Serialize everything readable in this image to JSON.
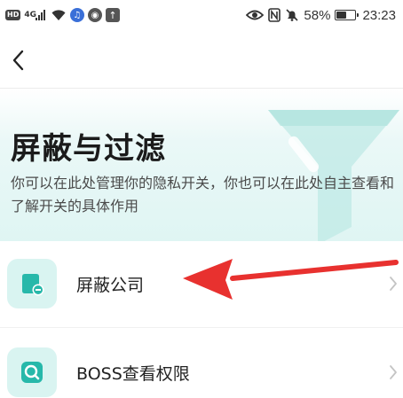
{
  "status_bar": {
    "hd_label": "HD",
    "network_label": "4G",
    "battery_percent": "58%",
    "battery_level": 0.58,
    "time": "23:23",
    "icons": [
      "hd-icon",
      "signal-icon",
      "wifi-icon",
      "music-icon",
      "browser-icon",
      "upload-icon",
      "eye-icon",
      "nfc-icon",
      "mute-icon",
      "battery-icon"
    ]
  },
  "nav": {
    "back_icon": "chevron-left-icon"
  },
  "header": {
    "title": "屏蔽与过滤",
    "description": "你可以在此处管理你的隐私开关，你也可以在此处自主查看和了解开关的具体作用",
    "illustration": "funnel-icon"
  },
  "list": {
    "items": [
      {
        "label": "屏蔽公司",
        "icon": "block-company-icon",
        "chevron": "chevron-right-icon"
      },
      {
        "label": "BOSS查看权限",
        "icon": "search-icon",
        "chevron": "chevron-right-icon"
      }
    ]
  },
  "annotation": {
    "arrow_color": "#e8312f",
    "points_to": "屏蔽公司"
  },
  "colors": {
    "accent": "#2ec4b6",
    "icon_bg": "#d9f4f1",
    "banner_bg": "#dff5f3",
    "arrow": "#e8312f"
  }
}
